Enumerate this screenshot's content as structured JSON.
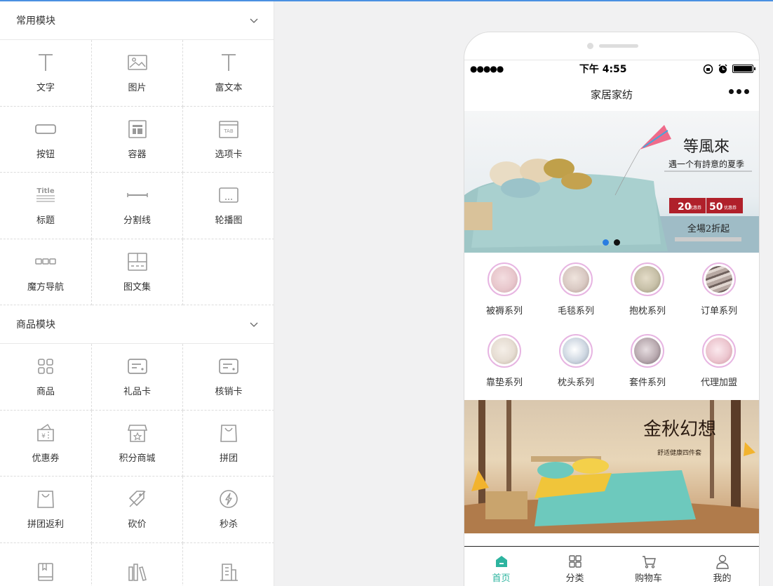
{
  "sections": [
    {
      "title": "常用模块",
      "items": [
        {
          "label": "文字",
          "icon": "text-icon"
        },
        {
          "label": "图片",
          "icon": "image-icon"
        },
        {
          "label": "富文本",
          "icon": "rich-text-icon"
        },
        {
          "label": "按钮",
          "icon": "button-icon"
        },
        {
          "label": "容器",
          "icon": "container-icon"
        },
        {
          "label": "选项卡",
          "icon": "tab-icon"
        },
        {
          "label": "标题",
          "icon": "title-icon"
        },
        {
          "label": "分割线",
          "icon": "divider-icon"
        },
        {
          "label": "轮播图",
          "icon": "carousel-icon"
        },
        {
          "label": "魔方导航",
          "icon": "cube-nav-icon"
        },
        {
          "label": "图文集",
          "icon": "gallery-icon"
        }
      ]
    },
    {
      "title": "商品模块",
      "items": [
        {
          "label": "商品",
          "icon": "goods-icon"
        },
        {
          "label": "礼品卡",
          "icon": "gift-card-icon"
        },
        {
          "label": "核销卡",
          "icon": "writeoff-card-icon"
        },
        {
          "label": "优惠券",
          "icon": "coupon-icon"
        },
        {
          "label": "积分商城",
          "icon": "points-mall-icon"
        },
        {
          "label": "拼团",
          "icon": "group-buy-icon"
        },
        {
          "label": "拼团返利",
          "icon": "group-rebate-icon"
        },
        {
          "label": "砍价",
          "icon": "bargain-icon"
        },
        {
          "label": "秒杀",
          "icon": "flash-sale-icon"
        },
        {
          "label": "",
          "icon": "book-icon"
        },
        {
          "label": "",
          "icon": "books-icon"
        },
        {
          "label": "",
          "icon": "building-icon"
        }
      ]
    }
  ],
  "phone": {
    "status": {
      "signal": "●●●●●",
      "time": "下午 4:55"
    },
    "nav_title": "家居家纺",
    "banner1": {
      "heading": "等風來",
      "subheading": "遇一个有詩意的夏季",
      "coupon1_value": "20",
      "coupon1_label": "优惠券",
      "coupon2_value": "50",
      "coupon2_label": "优惠券",
      "promo": "全場2折起"
    },
    "categories": [
      {
        "label": "被褥系列",
        "color": "#e8c7cc"
      },
      {
        "label": "毛毯系列",
        "color": "#d9c9c3"
      },
      {
        "label": "抱枕系列",
        "color": "#c7c0a8"
      },
      {
        "label": "订单系列",
        "color": "#b8a9a3"
      },
      {
        "label": "靠垫系列",
        "color": "#e6ddd3"
      },
      {
        "label": "枕头系列",
        "color": "#cfd8e2"
      },
      {
        "label": "套件系列",
        "color": "#b9aab0"
      },
      {
        "label": "代理加盟",
        "color": "#ecc6cf"
      }
    ],
    "banner2": {
      "heading": "金秋幻想",
      "subheading": "舒适健康四件套"
    },
    "tabs": [
      {
        "label": "首页",
        "icon": "home-icon"
      },
      {
        "label": "分类",
        "icon": "category-icon"
      },
      {
        "label": "购物车",
        "icon": "cart-icon"
      },
      {
        "label": "我的",
        "icon": "user-icon"
      }
    ],
    "accent": "#2db49f"
  }
}
